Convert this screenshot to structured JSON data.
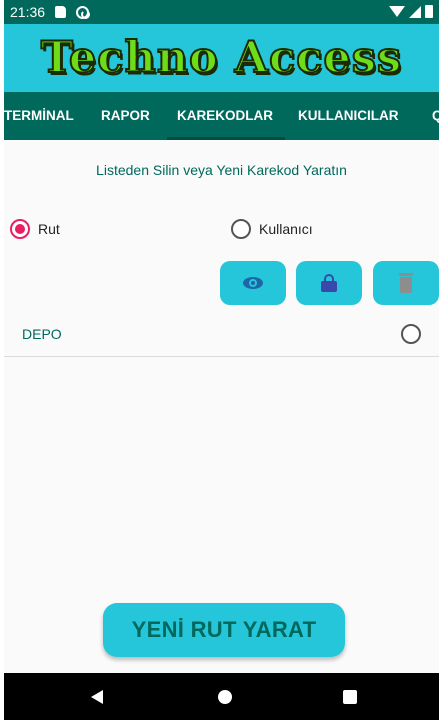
{
  "status_bar": {
    "time": "21:36"
  },
  "app": {
    "logo_text": "Techno Access"
  },
  "tabs": [
    {
      "label": "TERMİNAL"
    },
    {
      "label": "RAPOR"
    },
    {
      "label": "KAREKODLAR",
      "selected": true
    },
    {
      "label": "KULLANICILAR"
    },
    {
      "label": "Q"
    }
  ],
  "main": {
    "instruction": "Listeden Silin veya Yeni Karekod Yaratın",
    "filter_options": [
      {
        "label": "Rut",
        "checked": true
      },
      {
        "label": "Kullanıcı",
        "checked": false
      }
    ],
    "actions": [
      {
        "icon": "eye-icon"
      },
      {
        "icon": "lock-icon"
      },
      {
        "icon": "trash-icon"
      }
    ],
    "list": [
      {
        "label": "DEPO",
        "checked": false
      }
    ],
    "create_button": "YENİ RUT YARAT"
  },
  "colors": {
    "primary_dark": "#00695c",
    "accent_cyan": "#26c6da",
    "radio_checked": "#e91e63",
    "logo_green": "#6fdc1a"
  }
}
